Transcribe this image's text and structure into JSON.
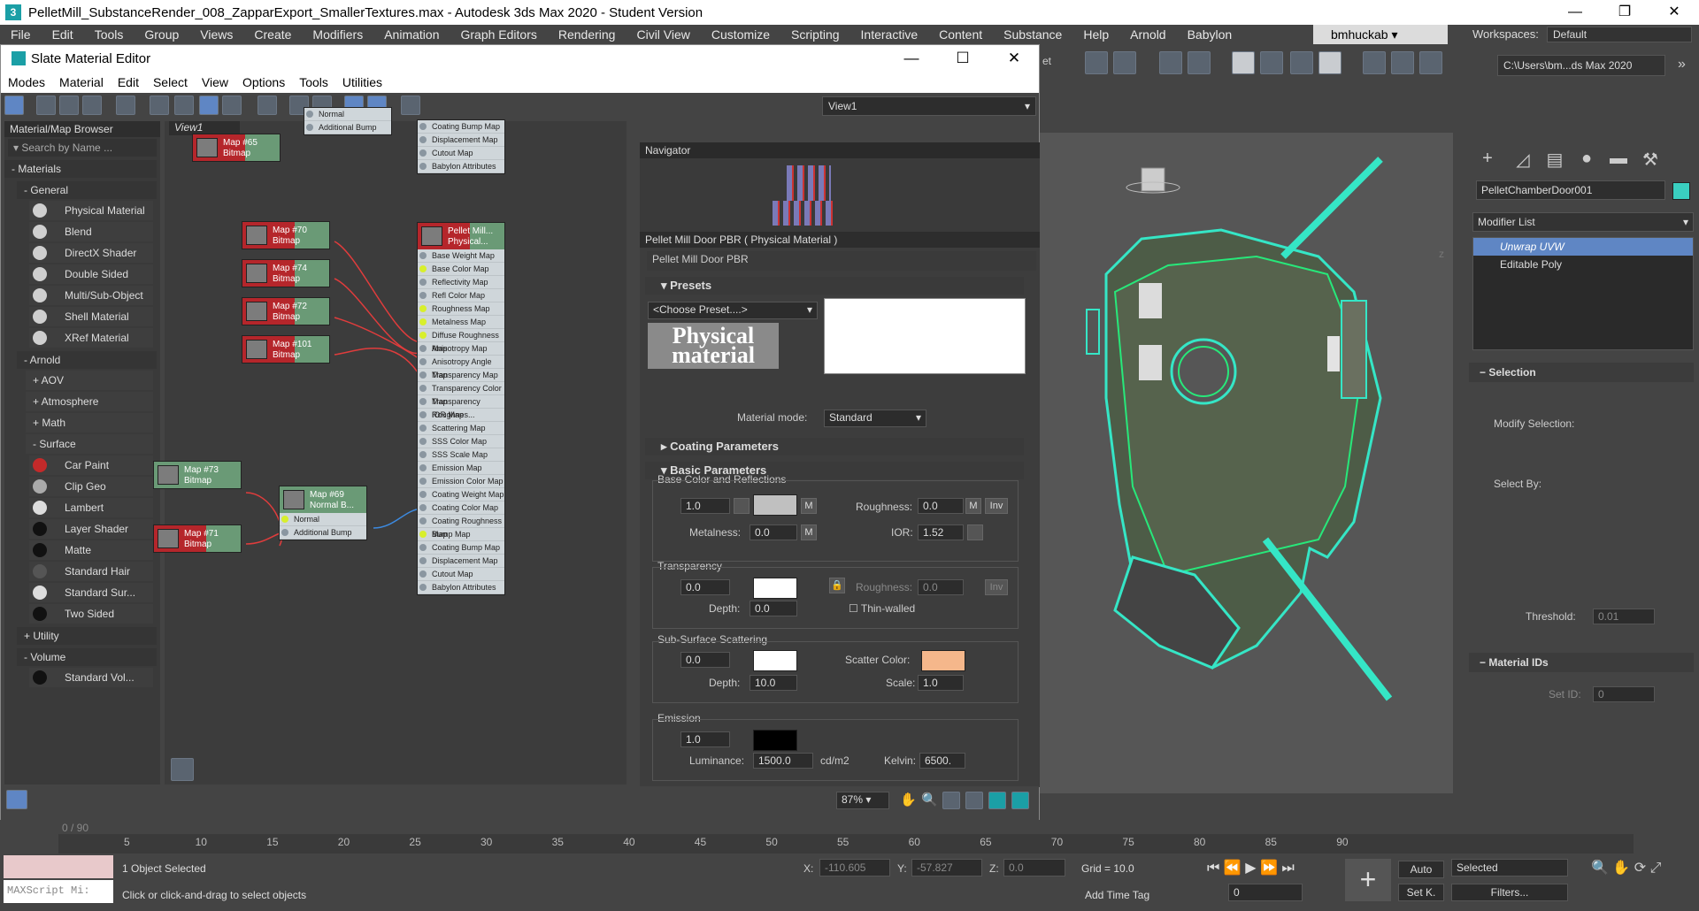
{
  "titlebar": {
    "title": "PelletMill_SubstanceRender_008_ZapparExport_SmallerTextures.max - Autodesk 3ds Max 2020 - Student Version",
    "minimize": "—",
    "maximize": "❐",
    "close": "✕"
  },
  "mainmenu": {
    "items": [
      "File",
      "Edit",
      "Tools",
      "Group",
      "Views",
      "Create",
      "Modifiers",
      "Animation",
      "Graph Editors",
      "Rendering",
      "Civil View",
      "Customize",
      "Scripting",
      "Interactive",
      "Content",
      "Substance",
      "Help",
      "Arnold",
      "Babylon"
    ],
    "user": "bmhuckab",
    "workspaces_label": "Workspaces:",
    "workspace_value": "Default"
  },
  "toolbar": {
    "path": "C:\\Users\\bm...ds Max 2020",
    "selset": "et"
  },
  "slate": {
    "title": "Slate Material Editor",
    "minimize": "—",
    "maximize": "☐",
    "close": "✕",
    "menu": [
      "Modes",
      "Material",
      "Edit",
      "Select",
      "View",
      "Options",
      "Tools",
      "Utilities"
    ],
    "view_dropdown": "View1",
    "browser": {
      "title": "Material/Map Browser",
      "search_placeholder": "Search by Name ...",
      "materials_label": "- Materials",
      "general_label": "- General",
      "general_items": [
        "Physical Material",
        "Blend",
        "DirectX Shader",
        "Double Sided",
        "Multi/Sub-Object",
        "Shell Material",
        "XRef Material"
      ],
      "arnold_label": "- Arnold",
      "arnold_subs": [
        "+ AOV",
        "+ Atmosphere",
        "+ Math"
      ],
      "surface_label": "- Surface",
      "surface_items": [
        "Car Paint",
        "Clip Geo",
        "Lambert",
        "Layer Shader",
        "Matte",
        "Standard Hair",
        "Standard Sur...",
        "Two Sided"
      ],
      "utility_label": "+ Utility",
      "volume_label": "- Volume",
      "volume_items": [
        "Standard Vol..."
      ]
    },
    "view_tab": "View1",
    "nodes": {
      "n65": {
        "title": "Map #65",
        "sub": "Bitmap"
      },
      "n70": {
        "title": "Map #70",
        "sub": "Bitmap"
      },
      "n74": {
        "title": "Map #74",
        "sub": "Bitmap"
      },
      "n72": {
        "title": "Map #72",
        "sub": "Bitmap"
      },
      "n101": {
        "title": "Map #101",
        "sub": "Bitmap"
      },
      "n73": {
        "title": "Map #73",
        "sub": "Bitmap"
      },
      "n71": {
        "title": "Map #71",
        "sub": "Bitmap"
      },
      "n69": {
        "title": "Map #69",
        "sub": "Normal B...",
        "slots": [
          "Normal",
          "Additional Bump"
        ]
      },
      "ntop": {
        "slots": [
          "Normal",
          "Additional Bump"
        ]
      },
      "topright": {
        "slots": [
          "Coating Bump Map",
          "Displacement Map",
          "Cutout Map",
          "Babylon Attributes"
        ]
      },
      "pbr": {
        "title": "Pellet Mill...",
        "sub": "Physical...",
        "slots": [
          "Base Weight Map",
          "Base Color Map",
          "Reflectivity Map",
          "Refl Color Map",
          "Roughness Map",
          "Metalness Map",
          "Diffuse Roughness Map",
          "Anisotropy Map",
          "Anisotropy Angle Map",
          "Transparency Map",
          "Transparency Color Map",
          "Transparency Roughnes...",
          "IOR Map",
          "Scattering Map",
          "SSS Color Map",
          "SSS Scale Map",
          "Emission Map",
          "Emission Color Map",
          "Coating Weight Map",
          "Coating Color Map",
          "Coating Roughness Map",
          "Bump Map",
          "Coating Bump Map",
          "Displacement Map",
          "Cutout Map",
          "Babylon Attributes"
        ]
      }
    },
    "navigator_title": "Navigator",
    "params": {
      "header": "Pellet Mill Door PBR  ( Physical Material )",
      "name": "Pellet Mill Door PBR",
      "presets_label": "Presets",
      "preset_dd": "<Choose Preset....>",
      "logo_text": "Physical material",
      "mode_label": "Material mode:",
      "mode_value": "Standard",
      "coating_label": "Coating Parameters",
      "basic_label": "Basic Parameters",
      "base_group": "Base Color and Reflections",
      "base_weight": "1.0",
      "roughness_label": "Roughness:",
      "roughness": "0.0",
      "inv": "Inv",
      "m": "M",
      "metalness_label": "Metalness:",
      "metalness": "0.0",
      "ior_label": "IOR:",
      "ior": "1.52",
      "trans_group": "Transparency",
      "trans_weight": "0.0",
      "trans_rough_label": "Roughness:",
      "trans_rough": "0.0",
      "depth_label": "Depth:",
      "trans_depth": "0.0",
      "thin": "Thin-walled",
      "sss_group": "Sub-Surface Scattering",
      "sss_weight": "0.0",
      "scatter_label": "Scatter Color:",
      "sss_depth": "10.0",
      "scale_label": "Scale:",
      "sss_scale": "1.0",
      "emi_group": "Emission",
      "emi_weight": "1.0",
      "lum_label": "Luminance:",
      "luminance": "1500.0",
      "lum_unit": "cd/m2",
      "kelvin_label": "Kelvin:",
      "kelvin": "6500."
    },
    "zoom": "87%"
  },
  "viewport": {
    "corner": "z"
  },
  "cmd": {
    "object_name": "PelletChamberDoor001",
    "modifier_list": "Modifier List",
    "stack": [
      "Unwrap UVW",
      "Editable Poly"
    ],
    "selection": "Selection",
    "modify_selection": "Modify Selection:",
    "select_by": "Select By:",
    "threshold_label": "Threshold:",
    "threshold": "0.01",
    "material_ids": "Material IDs",
    "set_id_label": "Set ID:",
    "set_id": "0"
  },
  "timeline": {
    "frame": "0 / 90",
    "ticks": [
      "5",
      "10",
      "15",
      "20",
      "25",
      "30",
      "35",
      "40",
      "45",
      "50",
      "55",
      "60",
      "65",
      "70",
      "75",
      "80",
      "85",
      "90"
    ]
  },
  "status": {
    "maxscript": "MAXScript Mi:",
    "objects_selected": "1 Object Selected",
    "hint": "Click or click-and-drag to select objects",
    "x_label": "X:",
    "x": "-110.605",
    "y_label": "Y:",
    "y": "-57.827",
    "z_label": "Z:",
    "z": "0.0",
    "grid": "Grid = 10.0",
    "add_time_tag": "Add Time Tag",
    "auto": "Auto",
    "setk": "Set K.",
    "selected": "Selected",
    "filters": "Filters...",
    "frame": "0"
  },
  "colors": {
    "scatter": "#f5b78b",
    "base_color": "#c0c0c0",
    "trans_color": "#ffffff",
    "sss_color": "#ffffff",
    "emission": "#000000",
    "outline": "#35e6c6"
  }
}
